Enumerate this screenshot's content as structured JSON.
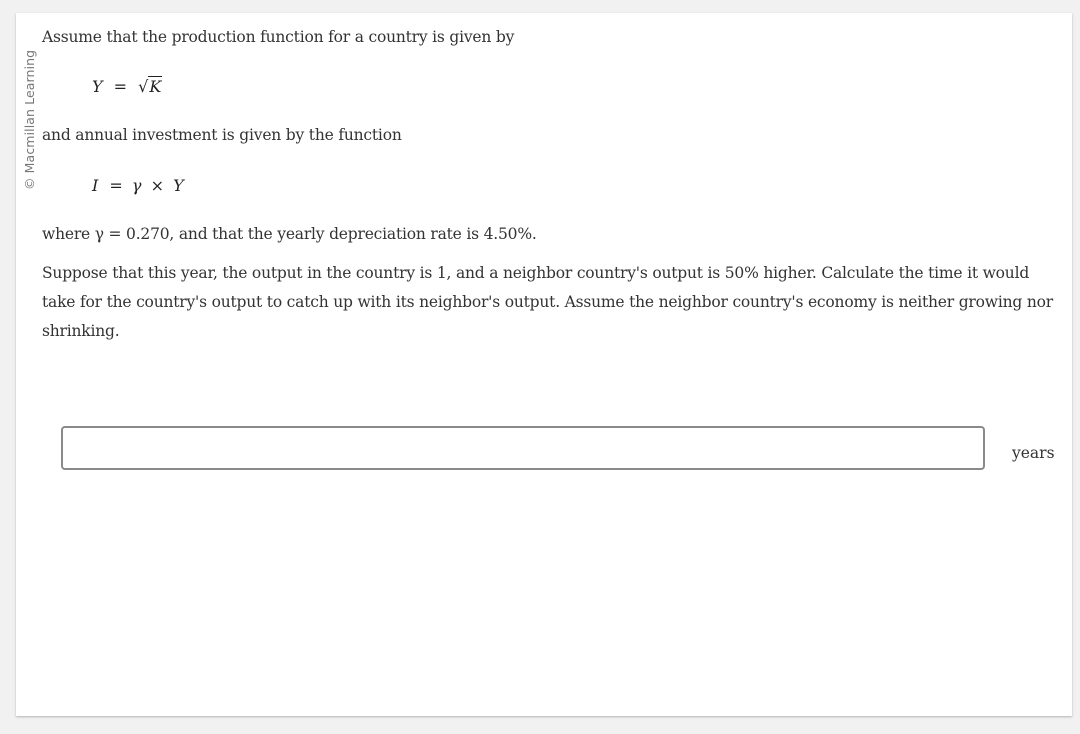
{
  "copyright": "© Macmillan Learning",
  "question": {
    "intro": "Assume that the production function for a country is given by",
    "production_function": {
      "lhs": "Y",
      "equals": "=",
      "sqrt_symbol": "√",
      "radicand": "K"
    },
    "investment_intro": "and annual investment is given by the function",
    "investment_function": {
      "lhs": "I",
      "equals": "=",
      "gamma": "γ",
      "times": "×",
      "rhs": "Y"
    },
    "parameters_text": "where γ = 0.270, and that the yearly depreciation rate is 4.50%.",
    "prompt": "Suppose that this year, the output in the country is 1, and a neighbor country's output is 50% higher. Calculate the time it would take for the country's output to catch up with its neighbor's output. Assume the neighbor country's economy is neither growing nor shrinking."
  },
  "answer": {
    "value": "",
    "placeholder": "",
    "unit": "years"
  }
}
